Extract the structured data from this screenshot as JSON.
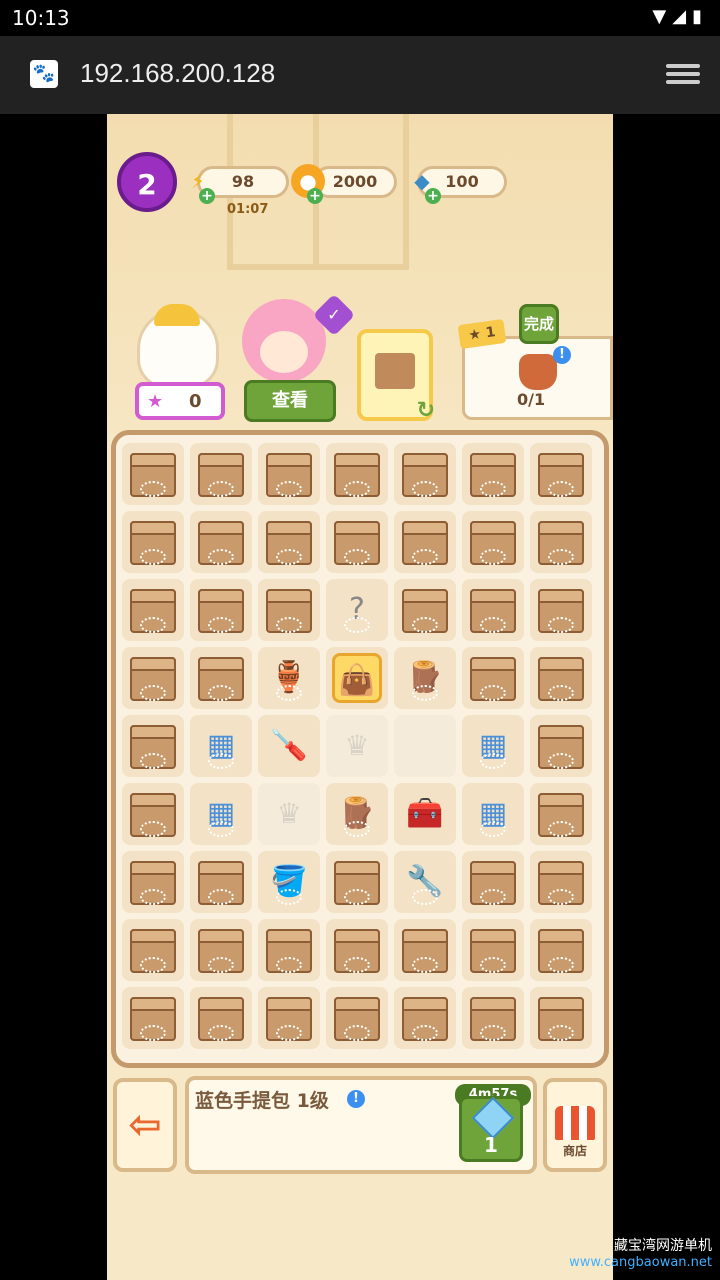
{
  "status": {
    "time": "10:13",
    "icons": "▼◢▮"
  },
  "browser": {
    "url": "192.168.200.128",
    "site_icon": "paw-icon"
  },
  "hud": {
    "level": "2",
    "energy": "98",
    "energy_timer": "01:07",
    "coins": "2000",
    "gems": "100"
  },
  "bunny": {
    "score": "0"
  },
  "girl": {
    "view_label": "查看"
  },
  "task": {
    "stars": "1",
    "done_label": "完成",
    "progress": "0/1"
  },
  "board_tiles": [
    [
      "box",
      "box",
      "box",
      "box",
      "box",
      "box",
      "box"
    ],
    [
      "box",
      "box",
      "box",
      "box",
      "box",
      "box",
      "box"
    ],
    [
      "box",
      "box",
      "box",
      "web",
      "box",
      "box",
      "box"
    ],
    [
      "box",
      "box",
      "web-vase",
      "bag",
      "web-item",
      "box",
      "box"
    ],
    [
      "box",
      "web-blue",
      "screwdriver",
      "crown",
      "empty",
      "web-blue",
      "box"
    ],
    [
      "box",
      "web-blue",
      "crown",
      "web-item",
      "toolbox",
      "web-blue",
      "box"
    ],
    [
      "box",
      "box",
      "web-pot",
      "box",
      "web-tool",
      "box",
      "box"
    ],
    [
      "box",
      "box",
      "box",
      "box",
      "box",
      "box",
      "box"
    ],
    [
      "box",
      "box",
      "box",
      "box",
      "box",
      "box",
      "box"
    ]
  ],
  "bottom": {
    "item_name": "蓝色手提包 1级",
    "cooldown": "4m57s",
    "sell_gems": "1",
    "shop_label": "商店"
  },
  "watermark": {
    "title": "藏宝湾网游单机",
    "site": "www.cangbaowan.net"
  },
  "colors": {
    "accent_green": "#6fa43a",
    "purple": "#9b2fc0",
    "board_border": "#c49a6c"
  }
}
